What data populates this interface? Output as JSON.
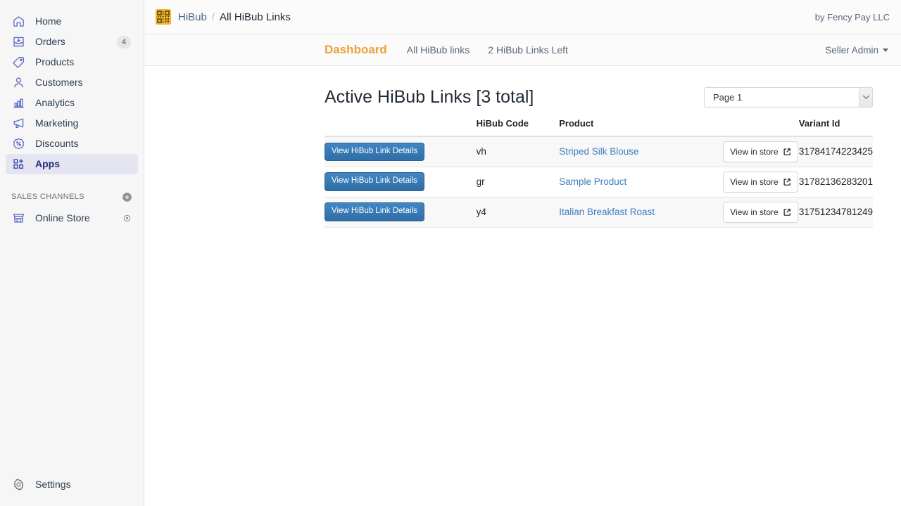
{
  "sidebar": {
    "items": [
      {
        "label": "Home",
        "icon": "home-icon",
        "badge": null,
        "active": false
      },
      {
        "label": "Orders",
        "icon": "orders-icon",
        "badge": "4",
        "active": false
      },
      {
        "label": "Products",
        "icon": "products-icon",
        "badge": null,
        "active": false
      },
      {
        "label": "Customers",
        "icon": "customers-icon",
        "badge": null,
        "active": false
      },
      {
        "label": "Analytics",
        "icon": "analytics-icon",
        "badge": null,
        "active": false
      },
      {
        "label": "Marketing",
        "icon": "marketing-icon",
        "badge": null,
        "active": false
      },
      {
        "label": "Discounts",
        "icon": "discounts-icon",
        "badge": null,
        "active": false
      },
      {
        "label": "Apps",
        "icon": "apps-icon",
        "badge": null,
        "active": true
      }
    ],
    "sales_channels": {
      "title": "SALES CHANNELS",
      "add_icon": "plus-circle-icon",
      "items": [
        {
          "label": "Online Store",
          "icon": "storefront-icon",
          "trailing_icon": "eye-icon"
        }
      ]
    },
    "settings": {
      "label": "Settings",
      "icon": "gear-icon"
    }
  },
  "topbar": {
    "app_logo_icon": "qr-code-app-icon",
    "breadcrumb_app": "HiBub",
    "breadcrumb_separator": "/",
    "breadcrumb_current": "All HiBub Links",
    "byline": "by Fency Pay LLC"
  },
  "tabbar": {
    "tabs": [
      {
        "label": "Dashboard",
        "active": true
      },
      {
        "label": "All HiBub links",
        "active": false
      },
      {
        "label": "2 HiBub Links Left",
        "active": false
      }
    ],
    "account_label": "Seller Admin",
    "account_caret_icon": "chevron-down-icon"
  },
  "main": {
    "page_title": "Active HiBub Links [3 total]",
    "page_select": {
      "value": "Page 1",
      "options": [
        "Page 1"
      ],
      "arrow_icon": "chevron-down-icon"
    },
    "table": {
      "headers": [
        "",
        "HiBub Code",
        "Product",
        "",
        "Variant Id"
      ],
      "details_button_label": "View HiBub Link Details",
      "store_button_label": "View in store",
      "store_button_icon": "external-link-icon",
      "rows": [
        {
          "code": "vh",
          "product": "Striped Silk Blouse",
          "variant_id": "31784174223425"
        },
        {
          "code": "gr",
          "product": "Sample Product",
          "variant_id": "31782136283201"
        },
        {
          "code": "y4",
          "product": "Italian Breakfast Roast",
          "variant_id": "31751234781249"
        }
      ]
    }
  },
  "colors": {
    "accent_orange": "#f0a03a",
    "link_blue": "#3d7ebd",
    "primary_button": "#3276b1",
    "sidebar_active_bg": "#e4e5f0",
    "sidebar_active_text": "#202e78",
    "app_logo_bg": "#f0b429"
  }
}
